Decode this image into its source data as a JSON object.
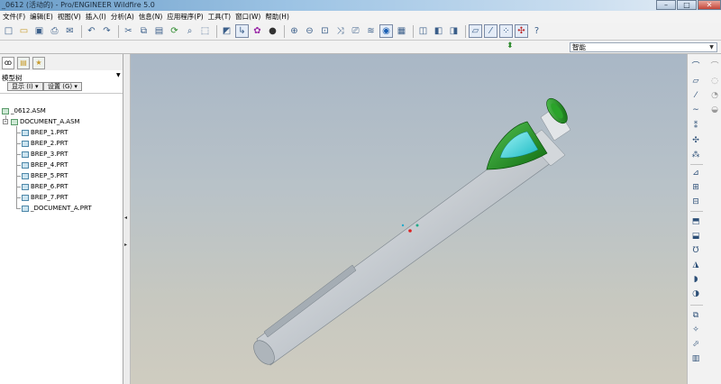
{
  "window": {
    "title": "_0612 (活动的) - Pro/ENGINEER Wildfire 5.0",
    "minimize": "–",
    "maximize": "□",
    "close": "✕"
  },
  "menu": [
    "文件(F)",
    "编辑(E)",
    "视图(V)",
    "插入(I)",
    "分析(A)",
    "信息(N)",
    "应用程序(P)",
    "工具(T)",
    "窗口(W)",
    "帮助(H)"
  ],
  "toolbar": {
    "icons": [
      "new-icon",
      "open-icon",
      "save-icon",
      "print-icon",
      "email-icon",
      "undo-icon",
      "redo-icon",
      "cut-icon",
      "copy-icon",
      "paste-icon",
      "regenerate-icon",
      "find-icon",
      "select-box-icon",
      "sketch-icon",
      "datum-icon",
      "appearance-icon",
      "orient-icon",
      "zoom-in-icon",
      "zoom-out-icon",
      "refit-icon",
      "reorient-icon",
      "saved-views-icon",
      "layers-icon",
      "display-style-icon",
      "shading-icon",
      "hidden-line-icon",
      "no-hidden-icon",
      "wireframe-icon",
      "datum-planes-icon",
      "datum-axes-icon",
      "datum-points-icon",
      "csys-icon",
      "help-icon"
    ]
  },
  "filter": {
    "selected": "智能"
  },
  "navigator": {
    "tabs": [
      "model-tree-tab",
      "folder-tab",
      "favorites-tab"
    ],
    "title": "模型树",
    "show_button": "显示 (I) ▾",
    "settings_button": "设置 (G) ▾",
    "root": "_0612.ASM",
    "assembly": "DOCUMENT_A.ASM",
    "parts": [
      "BREP_1.PRT",
      "BREP_2.PRT",
      "BREP_3.PRT",
      "BREP_4.PRT",
      "BREP_5.PRT",
      "BREP_6.PRT",
      "BREP_7.PRT",
      "_DOCUMENT_A.PRT"
    ]
  },
  "colors": {
    "model_body": "#c9ced3",
    "cap_green": "#1e8a1e",
    "cap_cyan": "#33d1d9",
    "viewport_top": "#a9b7c6",
    "viewport_bottom": "#cfccc0"
  },
  "rightbar": {
    "icons": [
      "datum-plane-tool-icon",
      "datum-axis-tool-icon",
      "sketched-curve-icon",
      "datum-curve-icon",
      "datum-point-icon",
      "csys-tool-icon",
      "annotation-icon",
      "extrude-icon",
      "revolve-icon",
      "sweep-icon",
      "blend-icon",
      "variable-sweep-icon",
      "hole-icon",
      "shell-icon",
      "rib-icon",
      "draft-icon",
      "round-icon",
      "chamfer-icon",
      "mirror-icon",
      "merge-icon",
      "trim-icon",
      "pattern-icon",
      "offset-icon",
      "thicken-icon"
    ]
  }
}
